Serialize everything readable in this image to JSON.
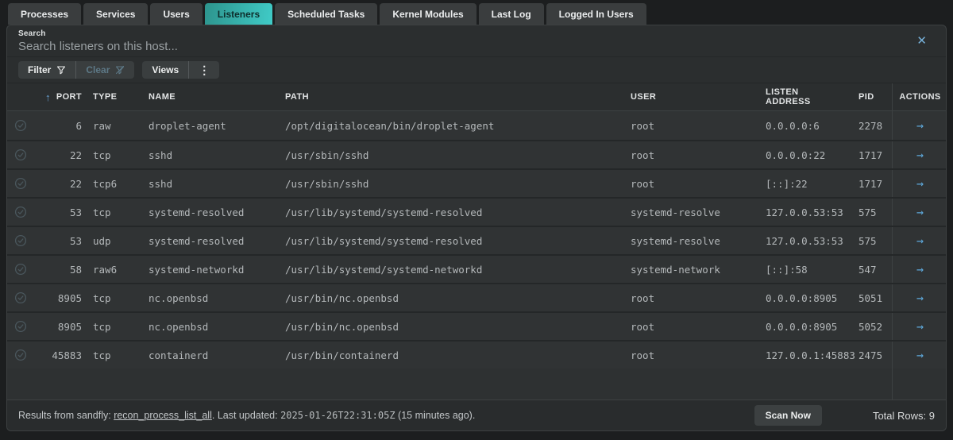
{
  "tabs": [
    {
      "label": "Processes",
      "active": false
    },
    {
      "label": "Services",
      "active": false
    },
    {
      "label": "Users",
      "active": false
    },
    {
      "label": "Listeners",
      "active": true
    },
    {
      "label": "Scheduled Tasks",
      "active": false
    },
    {
      "label": "Kernel Modules",
      "active": false
    },
    {
      "label": "Last Log",
      "active": false
    },
    {
      "label": "Logged In Users",
      "active": false
    }
  ],
  "search": {
    "label": "Search",
    "value": "",
    "placeholder": "Search listeners on this host..."
  },
  "toolbar": {
    "filter_label": "Filter",
    "clear_label": "Clear",
    "views_label": "Views"
  },
  "table": {
    "columns": [
      "PORT",
      "TYPE",
      "NAME",
      "PATH",
      "USER",
      "LISTEN ADDRESS",
      "PID",
      "ACTIONS"
    ],
    "rows": [
      {
        "port": "6",
        "type": "raw",
        "name": "droplet-agent",
        "path": "/opt/digitalocean/bin/droplet-agent",
        "user": "root",
        "listen_address": "0.0.0.0:6",
        "pid": "2278"
      },
      {
        "port": "22",
        "type": "tcp",
        "name": "sshd",
        "path": "/usr/sbin/sshd",
        "user": "root",
        "listen_address": "0.0.0.0:22",
        "pid": "1717"
      },
      {
        "port": "22",
        "type": "tcp6",
        "name": "sshd",
        "path": "/usr/sbin/sshd",
        "user": "root",
        "listen_address": "[::]:22",
        "pid": "1717"
      },
      {
        "port": "53",
        "type": "tcp",
        "name": "systemd-resolved",
        "path": "/usr/lib/systemd/systemd-resolved",
        "user": "systemd-resolve",
        "listen_address": "127.0.0.53:53",
        "pid": "575"
      },
      {
        "port": "53",
        "type": "udp",
        "name": "systemd-resolved",
        "path": "/usr/lib/systemd/systemd-resolved",
        "user": "systemd-resolve",
        "listen_address": "127.0.0.53:53",
        "pid": "575"
      },
      {
        "port": "58",
        "type": "raw6",
        "name": "systemd-networkd",
        "path": "/usr/lib/systemd/systemd-networkd",
        "user": "systemd-network",
        "listen_address": "[::]:58",
        "pid": "547"
      },
      {
        "port": "8905",
        "type": "tcp",
        "name": "nc.openbsd",
        "path": "/usr/bin/nc.openbsd",
        "user": "root",
        "listen_address": "0.0.0.0:8905",
        "pid": "5051"
      },
      {
        "port": "8905",
        "type": "tcp",
        "name": "nc.openbsd",
        "path": "/usr/bin/nc.openbsd",
        "user": "root",
        "listen_address": "0.0.0.0:8905",
        "pid": "5052"
      },
      {
        "port": "45883",
        "type": "tcp",
        "name": "containerd",
        "path": "/usr/bin/containerd",
        "user": "root",
        "listen_address": "127.0.0.1:45883",
        "pid": "2475"
      }
    ]
  },
  "footer": {
    "results_prefix": "Results from sandfly: ",
    "sandfly_name": "recon_process_list_all",
    "updated_middle": ". Last updated: ",
    "timestamp": "2025-01-26T22:31:05Z",
    "updated_suffix": " (15 minutes ago).",
    "scan_button": "Scan Now",
    "total_rows": "Total Rows: 9"
  },
  "icons": {
    "close": "✕",
    "sort_ascending": "↑",
    "kebab": "⋮",
    "row_arrow": "→"
  },
  "colors": {
    "accent_teal": "#40cbc7",
    "accent_blue": "#63a9da",
    "panel_bg": "#2b2e2f",
    "row_bg": "#303334"
  }
}
